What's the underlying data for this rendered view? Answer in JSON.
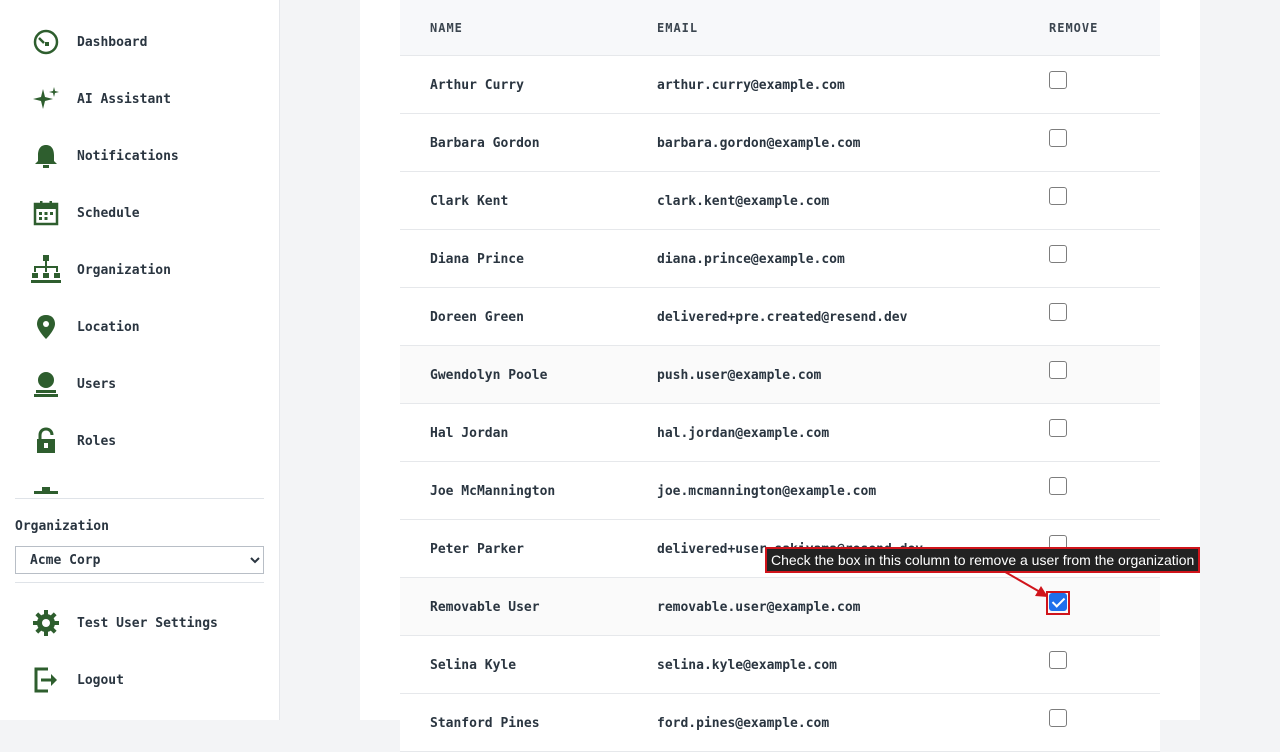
{
  "sidebar": {
    "items": [
      {
        "label": "Dashboard",
        "icon": "dashboard-icon"
      },
      {
        "label": "AI Assistant",
        "icon": "sparkle-icon"
      },
      {
        "label": "Notifications",
        "icon": "bell-icon"
      },
      {
        "label": "Schedule",
        "icon": "calendar-icon"
      },
      {
        "label": "Organization",
        "icon": "org-chart-icon"
      },
      {
        "label": "Location",
        "icon": "map-pin-icon"
      },
      {
        "label": "Users",
        "icon": "user-icon"
      },
      {
        "label": "Roles",
        "icon": "lock-icon"
      }
    ],
    "organization_label": "Organization",
    "organization_selected": "Acme Corp",
    "settings_label": "Test User Settings",
    "logout_label": "Logout"
  },
  "table": {
    "headers": {
      "name": "NAME",
      "email": "EMAIL",
      "remove": "REMOVE"
    },
    "rows": [
      {
        "name": "Arthur Curry",
        "email": "arthur.curry@example.com",
        "checked": false
      },
      {
        "name": "Barbara Gordon",
        "email": "barbara.gordon@example.com",
        "checked": false
      },
      {
        "name": "Clark Kent",
        "email": "clark.kent@example.com",
        "checked": false
      },
      {
        "name": "Diana Prince",
        "email": "diana.prince@example.com",
        "checked": false
      },
      {
        "name": "Doreen Green",
        "email": "delivered+pre.created@resend.dev",
        "checked": false
      },
      {
        "name": "Gwendolyn Poole",
        "email": "push.user@example.com",
        "checked": false
      },
      {
        "name": "Hal Jordan",
        "email": "hal.jordan@example.com",
        "checked": false
      },
      {
        "name": "Joe McMannington",
        "email": "joe.mcmannington@example.com",
        "checked": false
      },
      {
        "name": "Peter Parker",
        "email": "delivered+user.sakiyama@resend.dev",
        "checked": false
      },
      {
        "name": "Removable User",
        "email": "removable.user@example.com",
        "checked": true
      },
      {
        "name": "Selina Kyle",
        "email": "selina.kyle@example.com",
        "checked": false
      },
      {
        "name": "Stanford Pines",
        "email": "ford.pines@example.com",
        "checked": false
      }
    ]
  },
  "annotation": {
    "text": "Check the box in this column to remove a user from the organization",
    "color": "#d0141b"
  },
  "colors": {
    "icon": "#2e5e2e",
    "checkbox_checked": "#1f6feb"
  }
}
